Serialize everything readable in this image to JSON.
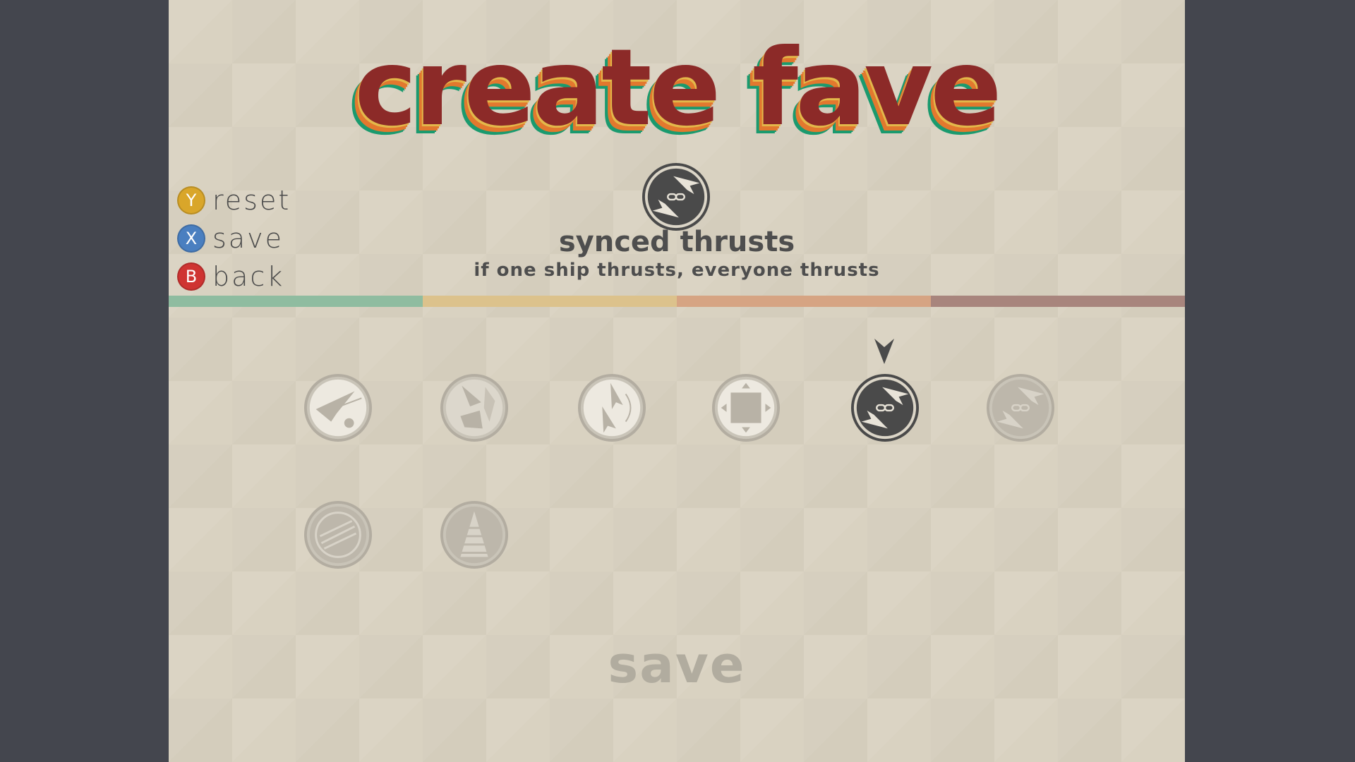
{
  "title": "create fave",
  "legend": [
    {
      "key": "Y",
      "label": "reset",
      "color": "#d9a62a"
    },
    {
      "key": "X",
      "label": "save",
      "color": "#4a7fc0"
    },
    {
      "key": "B",
      "label": "back",
      "color": "#cf3432"
    }
  ],
  "selected_modifier": {
    "name": "synced thrusts",
    "description": "if one ship thrusts, everyone thrusts",
    "icon": "synced-thrusts-icon"
  },
  "color_bar": [
    "#8fbca0",
    "#dcc28c",
    "#d6a483",
    "#a8857d"
  ],
  "modifiers": [
    {
      "icon": "ship-gear-icon",
      "selected": false
    },
    {
      "icon": "ship-shards-icon",
      "selected": false
    },
    {
      "icon": "ship-spin-icon",
      "selected": false
    },
    {
      "icon": "arena-frame-icon",
      "selected": false
    },
    {
      "icon": "synced-thrusts-icon",
      "selected": true
    },
    {
      "icon": "synced-thrusts-alt-icon",
      "selected": false
    },
    {
      "icon": "ship-stripes-icon",
      "selected": false
    },
    {
      "icon": "tower-icon",
      "selected": false
    }
  ],
  "save_label": "save"
}
